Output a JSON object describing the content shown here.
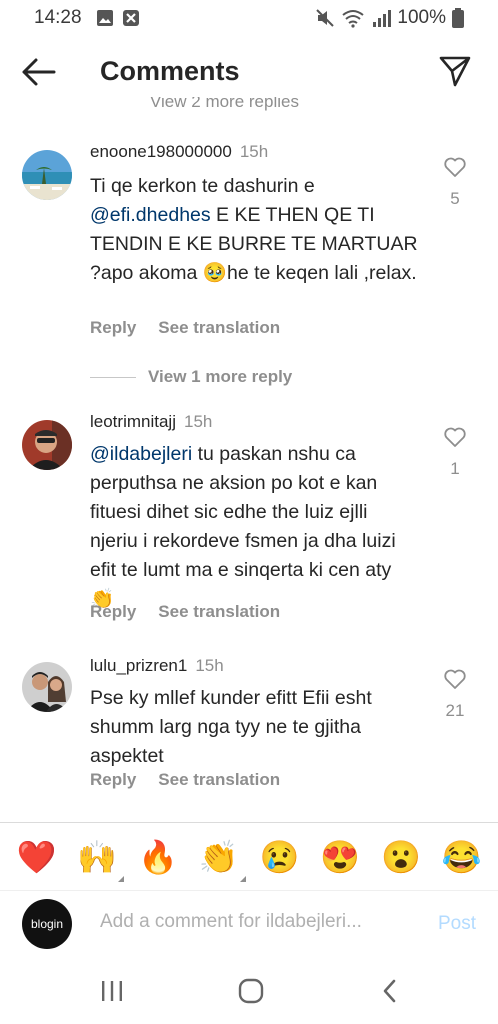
{
  "status": {
    "time": "14:28",
    "battery": "100%"
  },
  "header": {
    "title": "Comments"
  },
  "partial_replies": "View 2 more replies",
  "comments": [
    {
      "user": "enoone198000000",
      "time": "15h",
      "mention": "@efi.dhedhes",
      "text_before": "Ti qe kerkon te dashurin e ",
      "text_after": "  E KE THEN QE TI TENDIN E KE BURRE TE MARTUAR ?apo akoma 🥹he te keqen lali ,relax.",
      "reply": "Reply",
      "see_translation": "See translation",
      "likes": "5"
    },
    {
      "user": "leotrimnitajj",
      "time": "15h",
      "mention": "@ildabejleri",
      "text_before": "",
      "text_after": "  tu paskan nshu ca perputhsa ne aksion po kot e kan fituesi dihet sic edhe the luiz ejlli njeriu i rekordeve fsmen ja dha luizi efit te lumt ma e sinqerta ki cen aty 👏",
      "reply": "Reply",
      "see_translation": "See translation",
      "likes": "1"
    },
    {
      "user": "lulu_prizren1",
      "time": "15h",
      "mention": "",
      "text_before": "Pse ky mllef kunder efitt  Efii esht shumm larg nga tyy  ne te gjitha aspektet",
      "text_after": "",
      "reply": "Reply",
      "see_translation": "See translation",
      "likes": "21"
    }
  ],
  "view_more_reply": "View 1 more reply",
  "emojis": [
    "❤️",
    "🙌",
    "🔥",
    "👏",
    "😢",
    "😍",
    "😮",
    "😂"
  ],
  "comment_input": {
    "placeholder": "Add a comment for ildabejleri...",
    "post_label": "Post"
  },
  "my_avatar_text": "blogin",
  "colors": {
    "mention": "#00376b",
    "secondary": "#8e8e8e",
    "post_disabled": "#b3dbff"
  }
}
